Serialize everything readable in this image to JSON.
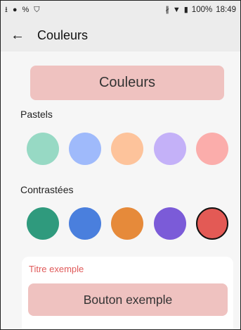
{
  "status_bar": {
    "left_icons": [
      "upload-icon",
      "app-icon",
      "link-icon",
      "shield-icon"
    ],
    "battery": "100%",
    "time": "18:49"
  },
  "app_bar": {
    "title": "Couleurs"
  },
  "header_button": {
    "label": "Couleurs"
  },
  "pastels": {
    "label": "Pastels",
    "colors": [
      "#97d9c4",
      "#9fbafb",
      "#fdc39b",
      "#c4b1f8",
      "#fbadab"
    ]
  },
  "contrasted": {
    "label": "Contrastées",
    "colors": [
      "#2f9a7d",
      "#4a7fdd",
      "#e68a3a",
      "#7b5bd8",
      "#e35a55"
    ],
    "selected_index": 4
  },
  "preview": {
    "title": "Titre exemple",
    "title_color": "#e05a5a",
    "button_label": "Bouton exemple"
  }
}
